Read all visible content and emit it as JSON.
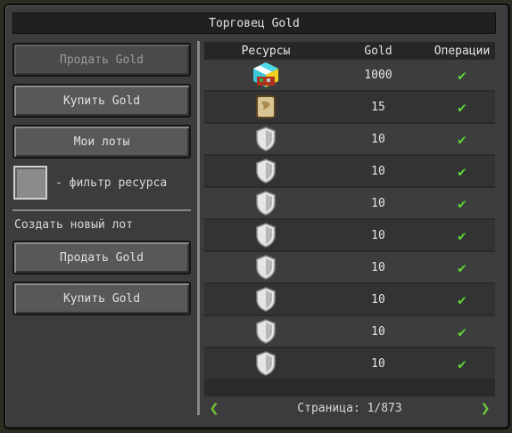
{
  "window": {
    "title": "Торговец Gold"
  },
  "left_panel": {
    "buttons_top": [
      {
        "label": "Продать Gold",
        "enabled": false
      },
      {
        "label": "Купить Gold",
        "enabled": true
      },
      {
        "label": "Мои лоты",
        "enabled": true
      }
    ],
    "filter_label": "- фильтр ресурса",
    "create_section_label": "Создать новый лот",
    "buttons_bottom": [
      {
        "label": "Продать Gold",
        "enabled": true
      },
      {
        "label": "Купить Gold",
        "enabled": true
      }
    ]
  },
  "table": {
    "headers": [
      "Ресурсы",
      "Gold",
      "Операции"
    ],
    "rows": [
      {
        "icon": "multicolor-block-icon",
        "gold": "1000"
      },
      {
        "icon": "map-scroll-icon",
        "gold": "15"
      },
      {
        "icon": "shield-icon",
        "gold": "10"
      },
      {
        "icon": "shield-icon",
        "gold": "10"
      },
      {
        "icon": "shield-icon",
        "gold": "10"
      },
      {
        "icon": "shield-icon",
        "gold": "10"
      },
      {
        "icon": "shield-icon",
        "gold": "10"
      },
      {
        "icon": "shield-icon",
        "gold": "10"
      },
      {
        "icon": "shield-icon",
        "gold": "10"
      },
      {
        "icon": "shield-icon",
        "gold": "10"
      }
    ],
    "operation_icon": "checkmark-icon"
  },
  "pagination": {
    "label": "Страница: 1/873",
    "prev_icon": "arrow-left-icon",
    "next_icon": "arrow-right-icon"
  },
  "colors": {
    "check": "#5fd13a",
    "arrow": "#6cc33b",
    "panel": "#3c3c3c"
  }
}
